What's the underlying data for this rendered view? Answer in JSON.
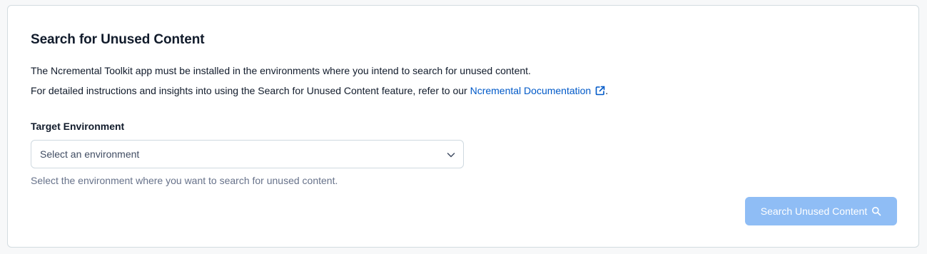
{
  "card": {
    "title": "Search for Unused Content",
    "line1": "The Ncremental Toolkit app must be installed in the environments where you intend to search for unused content.",
    "line2_prefix": "For detailed instructions and insights into using the Search for Unused Content feature, refer to our ",
    "line2_link": "Ncremental Documentation",
    "line2_suffix": "."
  },
  "environment_field": {
    "label": "Target Environment",
    "selected_value": "Select an environment",
    "helper_text": "Select the environment where you want to search for unused content."
  },
  "actions": {
    "search_button_label": "Search Unused Content",
    "search_button_disabled": true
  },
  "icons": {
    "link": "external-link-icon",
    "select": "chevron-down-icon",
    "button": "search-icon"
  },
  "colors": {
    "link": "#0059c8",
    "button_disabled_bg": "#8fbdf5",
    "text_primary": "#111b2b",
    "text_muted": "#67728a",
    "border": "#cfd9e0"
  }
}
